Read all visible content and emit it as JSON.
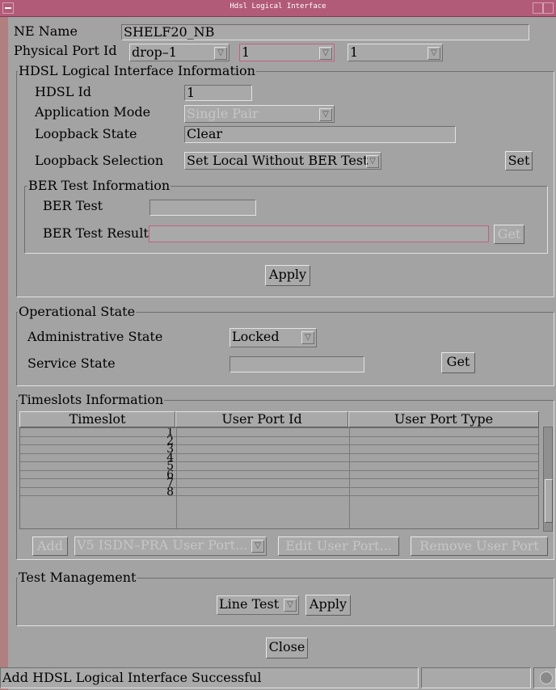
{
  "window": {
    "title": "Hdsl Logical Interface"
  },
  "ne": {
    "label": "NE Name",
    "value": "SHELF20_NB"
  },
  "physical_port": {
    "label": "Physical Port Id",
    "drop_value": "drop–1",
    "slot_value": "1",
    "port_value": "1"
  },
  "hdsl_group": {
    "title": "HDSL Logical Interface Information",
    "hdsl_id_label": "HDSL Id",
    "hdsl_id_value": "1",
    "app_mode_label": "Application Mode",
    "app_mode_value": "Single Pair",
    "loopback_state_label": "Loopback State",
    "loopback_state_value": "Clear",
    "loopback_selection_label": "Loopback Selection",
    "loopback_selection_value": "Set Local Without BER Test",
    "set_button": "Set",
    "ber_group_title": "BER Test Information",
    "ber_test_label": "BER Test",
    "ber_test_value": "",
    "ber_results_label": "BER Test Results",
    "ber_results_value": "",
    "get_button": "Get",
    "apply_button": "Apply"
  },
  "operational": {
    "title": "Operational State",
    "admin_label": "Administrative State",
    "admin_value": "Locked",
    "service_label": "Service State",
    "service_value": "",
    "get_button": "Get"
  },
  "timeslots": {
    "title": "Timeslots Information",
    "columns": [
      "Timeslot",
      "User Port Id",
      "User Port Type"
    ],
    "rows": [
      {
        "timeslot": "1",
        "user_port_id": "",
        "user_port_type": ""
      },
      {
        "timeslot": "2",
        "user_port_id": "",
        "user_port_type": ""
      },
      {
        "timeslot": "3",
        "user_port_id": "",
        "user_port_type": ""
      },
      {
        "timeslot": "4",
        "user_port_id": "",
        "user_port_type": ""
      },
      {
        "timeslot": "5",
        "user_port_id": "",
        "user_port_type": ""
      },
      {
        "timeslot": "6",
        "user_port_id": "",
        "user_port_type": ""
      },
      {
        "timeslot": "7",
        "user_port_id": "",
        "user_port_type": ""
      },
      {
        "timeslot": "8",
        "user_port_id": "",
        "user_port_type": ""
      }
    ],
    "add_button": "Add",
    "port_type_value": "V5 ISDN–PRA User Port...",
    "edit_button": "Edit User Port...",
    "remove_button": "Remove User Port"
  },
  "test_mgmt": {
    "title": "Test Management",
    "test_value": "Line Test",
    "apply_button": "Apply"
  },
  "close_button": "Close",
  "status": {
    "message": "Add HDSL Logical Interface Successful"
  },
  "colors": {
    "titlebar": "#b25b78",
    "background": "#a3a3a3",
    "disabled_text": "#c6c6c6",
    "highlight_border": "#c06080"
  }
}
